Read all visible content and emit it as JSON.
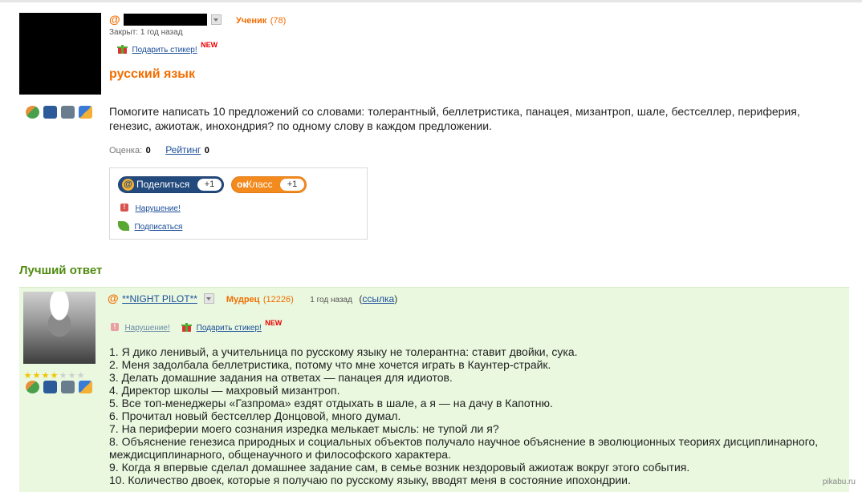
{
  "question": {
    "author_rank": "Ученик",
    "author_points": "(78)",
    "closed_text": "Закрыт: 1 год назад",
    "gift_sticker": "Подарить стикер!",
    "new_badge": "NEW",
    "title": "русский язык",
    "body": "Помогите написать 10 предложений со словами: толерантный, беллетристика, панацея, мизантроп, шале, бестселлер, периферия, генезис, ажиотаж, инохондрия? по одному слову в каждом предложении.",
    "rating_label": "Оценка:",
    "rating_value": "0",
    "rank_link": "Рейтинг",
    "rank_value": "0"
  },
  "share": {
    "share_label": "Поделиться",
    "share_count": "+1",
    "class_label": "Класс",
    "class_count": "+1",
    "report_label": "Нарушение!",
    "subscribe_label": "Подписаться"
  },
  "best_answer": {
    "heading": "Лучший ответ",
    "author_name": "**NIGHT PILOT**",
    "author_rank": "Мудрец",
    "author_points": "(12226)",
    "time": "1 год назад",
    "link_label": "ссылка",
    "report_label": "Нарушение!",
    "gift_sticker": "Подарить стикер!",
    "new_badge": "NEW",
    "stars": 4,
    "stars_total": 7,
    "items": [
      "1. Я дико ленивый, а учительница по русскому языку не толерантна: ставит двойки, сука.",
      "2. Меня задолбала беллетристика, потому что мне хочется играть в Каунтер-страйк.",
      "3. Делать домашние задания на ответах — панацея для идиотов.",
      "4. Директор школы — махровый мизантроп.",
      "5. Все топ-менеджеры «Газпрома» ездят отдыхать в шале, а я — на дачу в Капотню.",
      "6. Прочитал новый бестселлер Донцовой, много думал.",
      "7. На периферии моего сознания изредка мелькает мысль: не тупой ли я?",
      "8. Объяснение генезиса природных и социальных объектов получало научное объяснение в эволюционных теориях дисциплинарного, междисциплинарного, общенаучного и философского характера.",
      "9. Когда я впервые сделал домашнее задание сам, в семье возник нездоровый ажиотаж вокруг этого события.",
      "10. Количество двоек, которые я получаю по русскому языку, вводят меня в состояние ипохондрии."
    ]
  },
  "watermark": "pikabu.ru",
  "colors": {
    "accent": "#f26d00",
    "best_bg": "#e9f8df",
    "best_title": "#4f8a10",
    "link": "#1a4d99"
  }
}
